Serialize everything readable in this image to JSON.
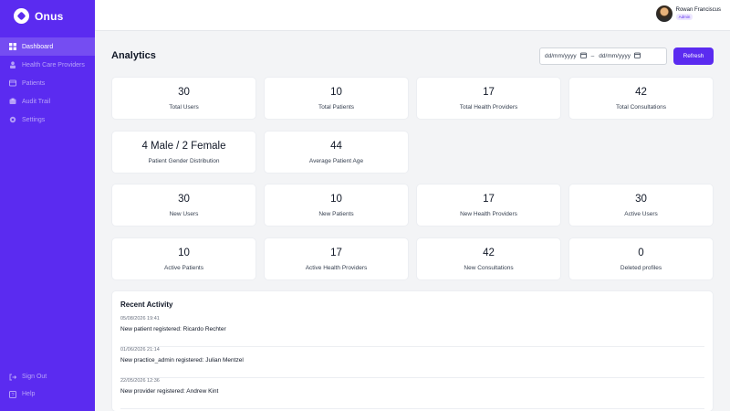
{
  "brand": {
    "name": "Onus"
  },
  "sidebar": {
    "items": [
      {
        "label": "Dashboard",
        "icon": "dashboard-icon",
        "active": true
      },
      {
        "label": "Health Care Providers",
        "icon": "provider-icon",
        "active": false
      },
      {
        "label": "Patients",
        "icon": "patients-icon",
        "active": false
      },
      {
        "label": "Audit Trail",
        "icon": "audit-icon",
        "active": false
      },
      {
        "label": "Settings",
        "icon": "gear-icon",
        "active": false
      }
    ],
    "bottom": [
      {
        "label": "Sign Out",
        "icon": "sign-out-icon"
      },
      {
        "label": "Help",
        "icon": "help-icon"
      }
    ]
  },
  "user": {
    "name": "Rowan Franciscus",
    "role": "Admin"
  },
  "header": {
    "title": "Analytics",
    "date_from_placeholder": "dd/mm/yyyy",
    "date_to_placeholder": "dd/mm/yyyy",
    "date_separator": "–",
    "refresh_label": "Refresh"
  },
  "stats": [
    {
      "value": "30",
      "label": "Total Users"
    },
    {
      "value": "10",
      "label": "Total Patients"
    },
    {
      "value": "17",
      "label": "Total Health Providers"
    },
    {
      "value": "42",
      "label": "Total Consultations"
    },
    {
      "value": "4 Male / 2 Female",
      "label": "Patient Gender Distribution"
    },
    {
      "value": "44",
      "label": "Average Patient Age"
    },
    {
      "value": "30",
      "label": "New Users"
    },
    {
      "value": "10",
      "label": "New Patients"
    },
    {
      "value": "17",
      "label": "New Health Providers"
    },
    {
      "value": "30",
      "label": "Active Users"
    },
    {
      "value": "10",
      "label": "Active Patients"
    },
    {
      "value": "17",
      "label": "Active Health Providers"
    },
    {
      "value": "42",
      "label": "New Consultations"
    },
    {
      "value": "0",
      "label": "Deleted profiles"
    }
  ],
  "activity": {
    "title": "Recent Activity",
    "items": [
      {
        "time": "05/08/2026 19:41",
        "text": "New patient registered: Ricardo Rechter"
      },
      {
        "time": "01/06/2026 21:14",
        "text": "New practice_admin registered: Julian Mentzel"
      },
      {
        "time": "22/05/2026 12:36",
        "text": "New provider registered: Andrew Kint"
      }
    ]
  },
  "colors": {
    "primary": "#5b2bf0",
    "background": "#f3f4f6",
    "card": "#ffffff"
  }
}
